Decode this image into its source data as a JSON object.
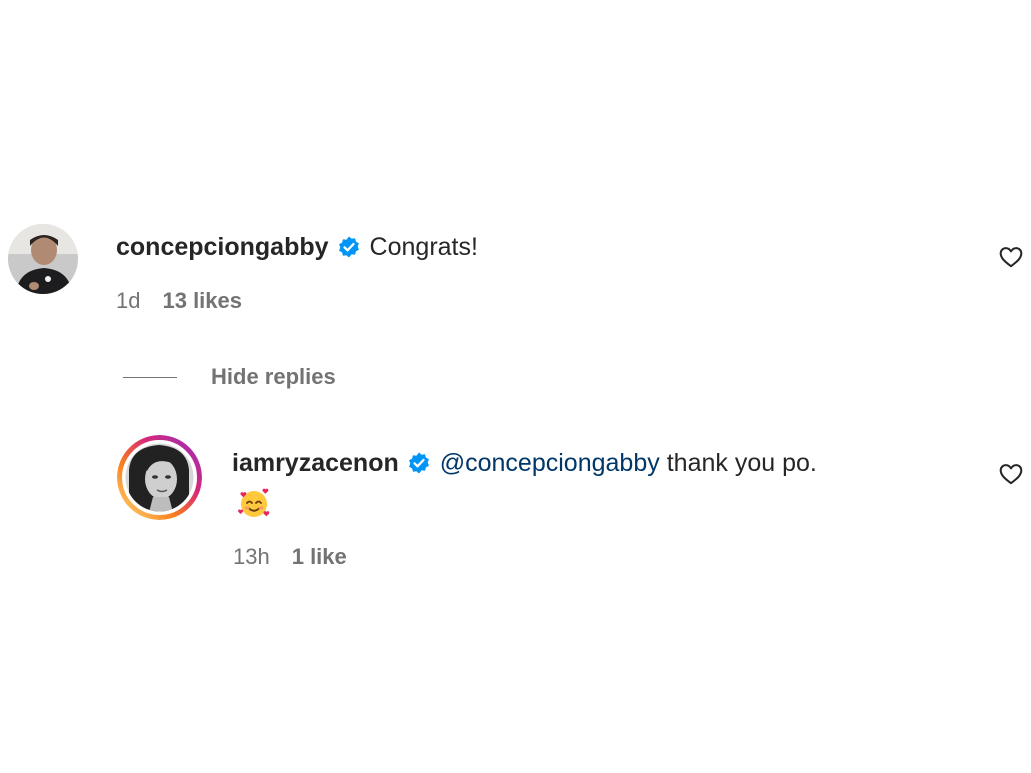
{
  "comment": {
    "username": "concepciongabby",
    "avatar_icon": "avatar-man-photo",
    "verified_icon": "verified-badge-icon",
    "text": "Congrats!",
    "time": "1d",
    "likes": "13 likes",
    "like_icon": "heart-outline-icon"
  },
  "hide_replies_label": "Hide replies",
  "reply": {
    "username": "iamryzacenon",
    "avatar_icon": "avatar-woman-photo-story-ring",
    "verified_icon": "verified-badge-icon",
    "mention": "@concepciongabby",
    "text": "thank you po.",
    "emoji_icon": "smiling-face-with-hearts-emoji",
    "time": "13h",
    "likes": "1 like",
    "like_icon": "heart-outline-icon"
  },
  "colors": {
    "text": "#262626",
    "secondary": "#737373",
    "mention": "#00376b",
    "verified": "#0095f6"
  }
}
